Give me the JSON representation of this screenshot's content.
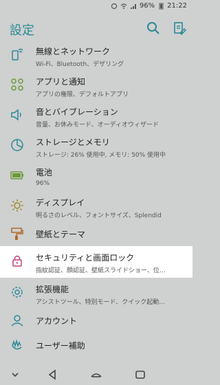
{
  "status": {
    "battery": "96%",
    "time": "21:22"
  },
  "header": {
    "title": "設定"
  },
  "items": [
    {
      "title": "無線とネットワーク",
      "subtitle": "Wi-Fi、Bluetooth、デザリング",
      "icon": "wifi-phone-icon",
      "color": "#2a8a96"
    },
    {
      "title": "アプリと通知",
      "subtitle": "アプリの権限、デフォルトアプリ",
      "icon": "apps-grid-icon",
      "color": "#6b9a36"
    },
    {
      "title": "音とバイブレーション",
      "subtitle": "音量、お休みモード、オーディオウィザード",
      "icon": "speaker-icon",
      "color": "#2a8a96"
    },
    {
      "title": "ストレージとメモリ",
      "subtitle": "ストレージ: 26% 使用中, メモリ: 50% 使用中",
      "icon": "storage-pie-icon",
      "color": "#2a8a96"
    },
    {
      "title": "電池",
      "subtitle": "96%",
      "icon": "battery-icon",
      "color": "#6b9a36"
    },
    {
      "title": "ディスプレイ",
      "subtitle": "明るさのレベル、フォントサイズ、Splendid",
      "icon": "brightness-icon",
      "color": "#a08a2a"
    },
    {
      "title": "壁紙とテーマ",
      "subtitle": "",
      "icon": "paint-roller-icon",
      "color": "#b06a2a"
    },
    {
      "title": "セキュリティと画面ロック",
      "subtitle": "指紋認証、顔認証、壁紙スライドショー、位…",
      "icon": "lock-icon",
      "color": "#c0407a",
      "selected": true
    },
    {
      "title": "拡張機能",
      "subtitle": "アシストツール、特別モード、クイック起動…",
      "icon": "gear-icon",
      "color": "#2a8a96"
    },
    {
      "title": "アカウント",
      "subtitle": "",
      "icon": "account-icon",
      "color": "#2a8a96"
    },
    {
      "title": "ユーザー補助",
      "subtitle": "",
      "icon": "accessibility-icon",
      "color": "#2a8a96"
    }
  ]
}
